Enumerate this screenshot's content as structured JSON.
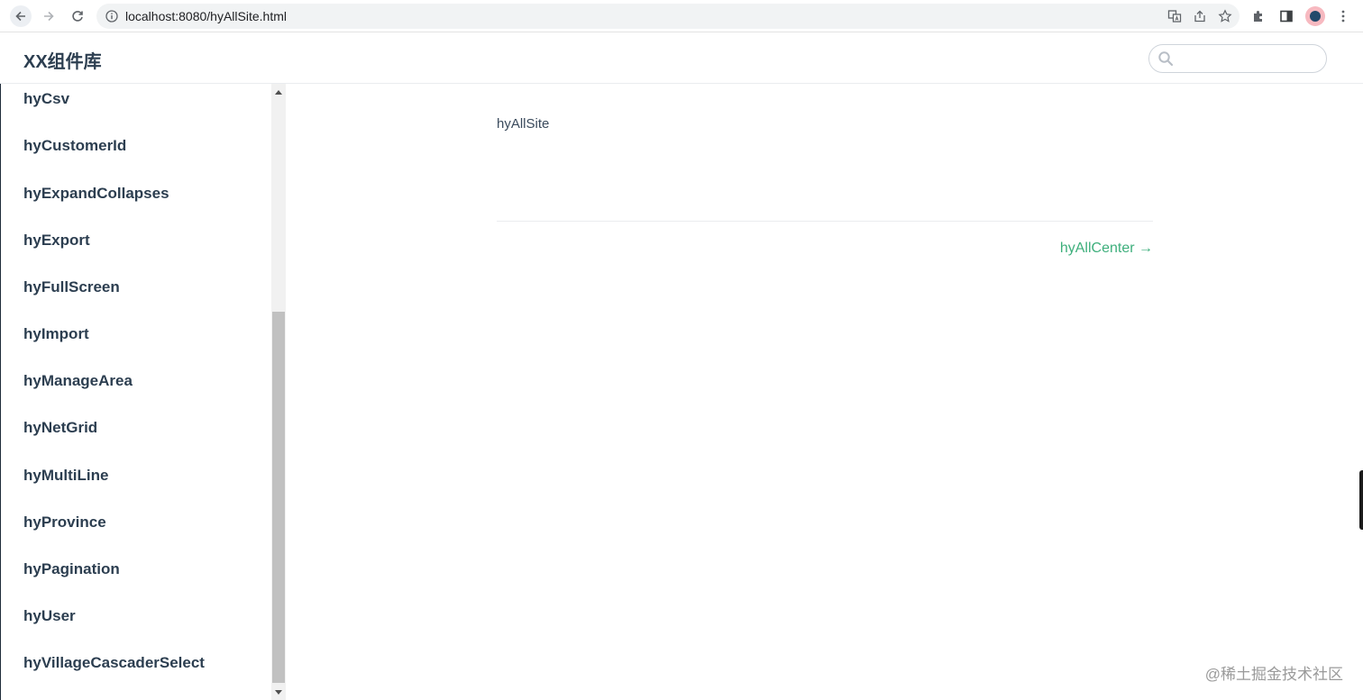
{
  "browser": {
    "url": "localhost:8080/hyAllSite.html"
  },
  "header": {
    "site_title": "XX组件库",
    "search_placeholder": ""
  },
  "sidebar": {
    "items": [
      "hyCsv",
      "hyCustomerId",
      "hyExpandCollapses",
      "hyExport",
      "hyFullScreen",
      "hyImport",
      "hyManageArea",
      "hyNetGrid",
      "hyMultiLine",
      "hyProvince",
      "hyPagination",
      "hyUser",
      "hyVillageCascaderSelect"
    ]
  },
  "main": {
    "page_text": "hyAllSite",
    "next_link": "hyAllCenter →"
  },
  "watermark": "@稀土掘金技术社区",
  "colors": {
    "accent": "#3eaf7c",
    "text": "#2c3e50"
  }
}
